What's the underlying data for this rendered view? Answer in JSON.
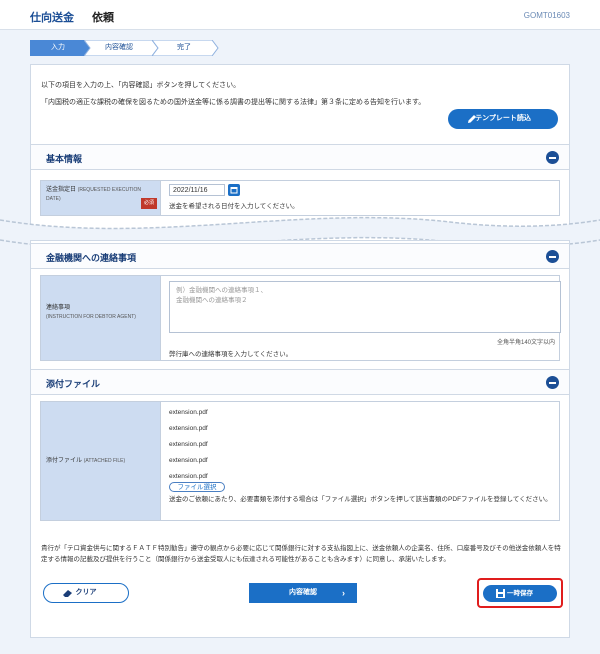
{
  "header": {
    "category": "仕向送金",
    "title": "依頼",
    "screen_code": "GOMT01603"
  },
  "steps": [
    {
      "label": "入力",
      "active": true
    },
    {
      "label": "内容確認",
      "active": false
    },
    {
      "label": "完了",
      "active": false
    }
  ],
  "intro": {
    "line1": "以下の項目を入力の上、「内容確認」ボタンを押してください。",
    "line2": "「内国税の適正な課税の確保を図るための国外送金等に係る調書の提出等に関する法律」第３条に定める告知を行います。",
    "template_button": "テンプレート読込"
  },
  "basic": {
    "title": "基本情報",
    "date_label": "送金指定日",
    "date_label_en": "(REQUESTED EXECUTION DATE)",
    "required": "必須",
    "date_value": "2022/11/16",
    "date_hint": "送金を希望される日付を入力してください。"
  },
  "bank": {
    "title": "金融機関への連絡事項",
    "label": "連絡事項",
    "label_en": "(INSTRUCTION FOR DEBTOR AGENT)",
    "placeholder_line1": "例）金融機関への連絡事項１、",
    "placeholder_line2": "金融機関への連絡事項２",
    "counter": "全角半角140文字以内",
    "hint": "弊行庫への連絡事項を入力してください。"
  },
  "attach": {
    "title": "添付ファイル",
    "label": "添付ファイル",
    "label_en": "(ATTACHED FILE)",
    "files": [
      "extension.pdf",
      "extension.pdf",
      "extension.pdf",
      "extension.pdf",
      "extension.pdf"
    ],
    "select_button": "ファイル選択",
    "hint": "送金のご依頼にあたり、必要書類を添付する場合は「ファイル選択」ボタンを押して該当書類のPDFファイルを登録してください。"
  },
  "notice": "貴行が「テロ資金供与に関するＦＡＴＦ特別勧告」遵守の観点から必要に応じて関係銀行に対する支払指図上に、送金依頼人の企業名、住所、口座番号及びその他送金依頼人を特定する情報の記載及び提供を行うこと（関係銀行から送金受取人にも伝達される可能性があることも含みます）に同意し、承諾いたします。",
  "buttons": {
    "clear": "クリア",
    "confirm": "内容確認",
    "save": "一時保存"
  },
  "colors": {
    "brand": "#1b6fc6",
    "navy": "#1c4f96",
    "highlight": "#e01d1d"
  }
}
